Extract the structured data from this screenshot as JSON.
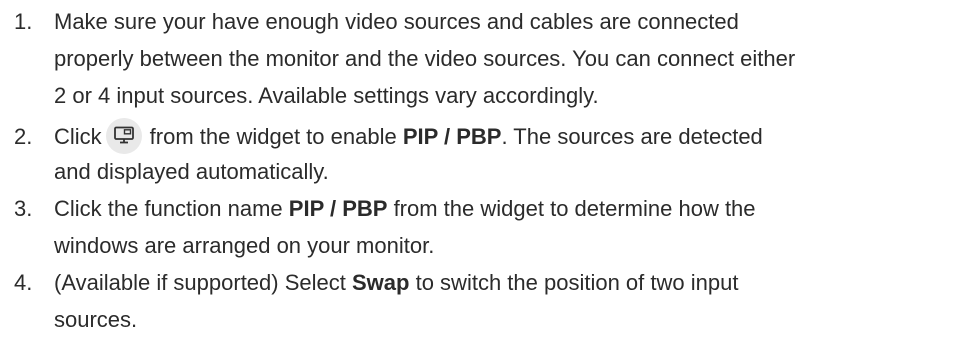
{
  "steps": [
    {
      "number": "1.",
      "lines": [
        "Make sure your have enough video sources and cables are connected",
        "properly between the monitor and the video sources. You can connect either",
        "2 or 4 input sources. Available settings vary accordingly."
      ]
    },
    {
      "number": "2.",
      "line1_a": "Click",
      "line1_b": "from the widget to enable",
      "line1_bold": "PIP / PBP",
      "line1_c": ". The sources are detected",
      "line2": "and displayed automatically.",
      "icon": "pip-monitor-icon"
    },
    {
      "number": "3.",
      "line1_a": "Click the function name",
      "line1_bold": "PIP / PBP",
      "line1_c": "from the widget to determine how the",
      "line2": "windows are arranged on your monitor."
    },
    {
      "number": "4.",
      "line1_a": "(Available if supported) Select",
      "line1_bold": "Swap",
      "line1_c": "to switch the position of two input",
      "line2": "sources."
    }
  ]
}
